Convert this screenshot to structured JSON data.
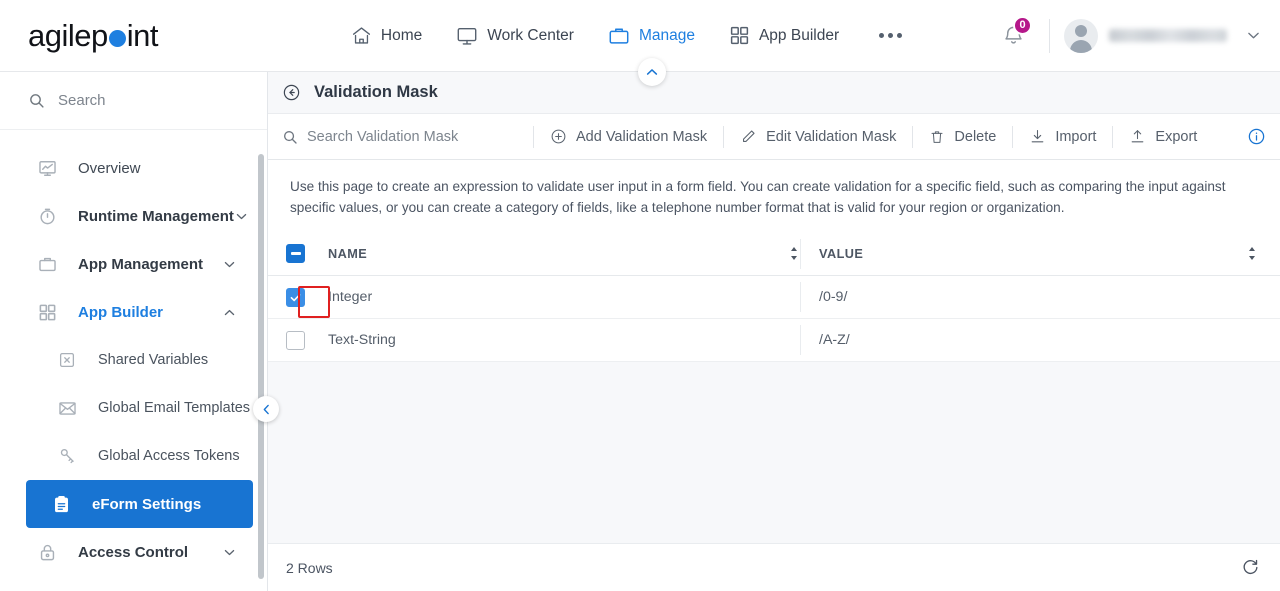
{
  "brand": {
    "name_part1": "agilep",
    "name_part2": "int",
    "dot_color": "#1e7fe0"
  },
  "header": {
    "nav": [
      {
        "label": "Home",
        "icon": "home-icon",
        "active": false
      },
      {
        "label": "Work Center",
        "icon": "monitor-icon",
        "active": false
      },
      {
        "label": "Manage",
        "icon": "briefcase-icon",
        "active": true
      },
      {
        "label": "App Builder",
        "icon": "grid-icon",
        "active": false
      }
    ],
    "more_label": "",
    "notifications": {
      "icon": "bell-icon",
      "count": "0",
      "badge_color": "#b5188a"
    },
    "account": {
      "name": "",
      "avatar_icon": "user-avatar-icon",
      "caret_icon": "chevron-down-icon"
    }
  },
  "sidebar": {
    "search": {
      "placeholder": "Search",
      "icon": "search-icon"
    },
    "items": [
      {
        "label": "Overview",
        "icon": "chart-icon",
        "level": "top",
        "state": "normal",
        "chevron": ""
      },
      {
        "label": "Runtime Management",
        "icon": "clock-icon",
        "level": "top",
        "state": "bold",
        "chevron": "down"
      },
      {
        "label": "App Management",
        "icon": "briefcase-icon",
        "level": "top",
        "state": "bold",
        "chevron": "down"
      },
      {
        "label": "App Builder",
        "icon": "grid-icon",
        "level": "top",
        "state": "blue",
        "chevron": "up"
      },
      {
        "label": "Shared Variables",
        "icon": "variable-icon",
        "level": "sub",
        "state": "normal",
        "chevron": ""
      },
      {
        "label": "Global Email Templates",
        "icon": "envelope-icon",
        "level": "sub",
        "state": "normal",
        "chevron": ""
      },
      {
        "label": "Global Access Tokens",
        "icon": "key-icon",
        "level": "sub",
        "state": "normal",
        "chevron": ""
      },
      {
        "label": "eForm Settings",
        "icon": "clipboard-icon",
        "level": "sub",
        "state": "active",
        "chevron": ""
      },
      {
        "label": "Access Control",
        "icon": "lock-icon",
        "level": "top",
        "state": "bold",
        "chevron": "down"
      }
    ],
    "collapse_button": {
      "icon": "chevron-left-icon"
    }
  },
  "main": {
    "back_icon": "back-arrow-icon",
    "page_title": "Validation Mask",
    "panel_toggle_icon": "chevron-up-icon",
    "toolbar": {
      "search_placeholder": "Search Validation Mask",
      "search_icon": "search-icon",
      "actions": [
        {
          "label": "Add Validation Mask",
          "icon": "plus-circle-icon"
        },
        {
          "label": "Edit Validation Mask",
          "icon": "pencil-icon"
        },
        {
          "label": "Delete",
          "icon": "trash-icon"
        },
        {
          "label": "Import",
          "icon": "download-icon"
        },
        {
          "label": "Export",
          "icon": "upload-icon"
        }
      ],
      "info_icon": "info-circle-icon"
    },
    "description": "Use this page to create an expression to validate user input in a form field. You can create validation for a specific field, such as comparing the input against specific values, or you can create a category of fields, like a telephone number format that is valid for your region or organization.",
    "table": {
      "select_all": {
        "state": "indeterminate",
        "icon": "checkbox-indeterminate-icon"
      },
      "columns": [
        {
          "key": "name",
          "label": "NAME",
          "sort_icon": "sort-icon"
        },
        {
          "key": "value",
          "label": "VALUE",
          "sort_icon": "sort-icon"
        }
      ],
      "rows": [
        {
          "selected": true,
          "name": "Integer",
          "value": "/0-9/",
          "highlighted": true
        },
        {
          "selected": false,
          "name": "Text-String",
          "value": "/A-Z/",
          "highlighted": false
        }
      ]
    },
    "footer": {
      "row_count_label": "2 Rows",
      "refresh_icon": "refresh-icon"
    }
  },
  "colors": {
    "accent": "#1874d2",
    "link": "#1e7fe0",
    "highlight": "#e02020",
    "badge": "#b5188a"
  }
}
